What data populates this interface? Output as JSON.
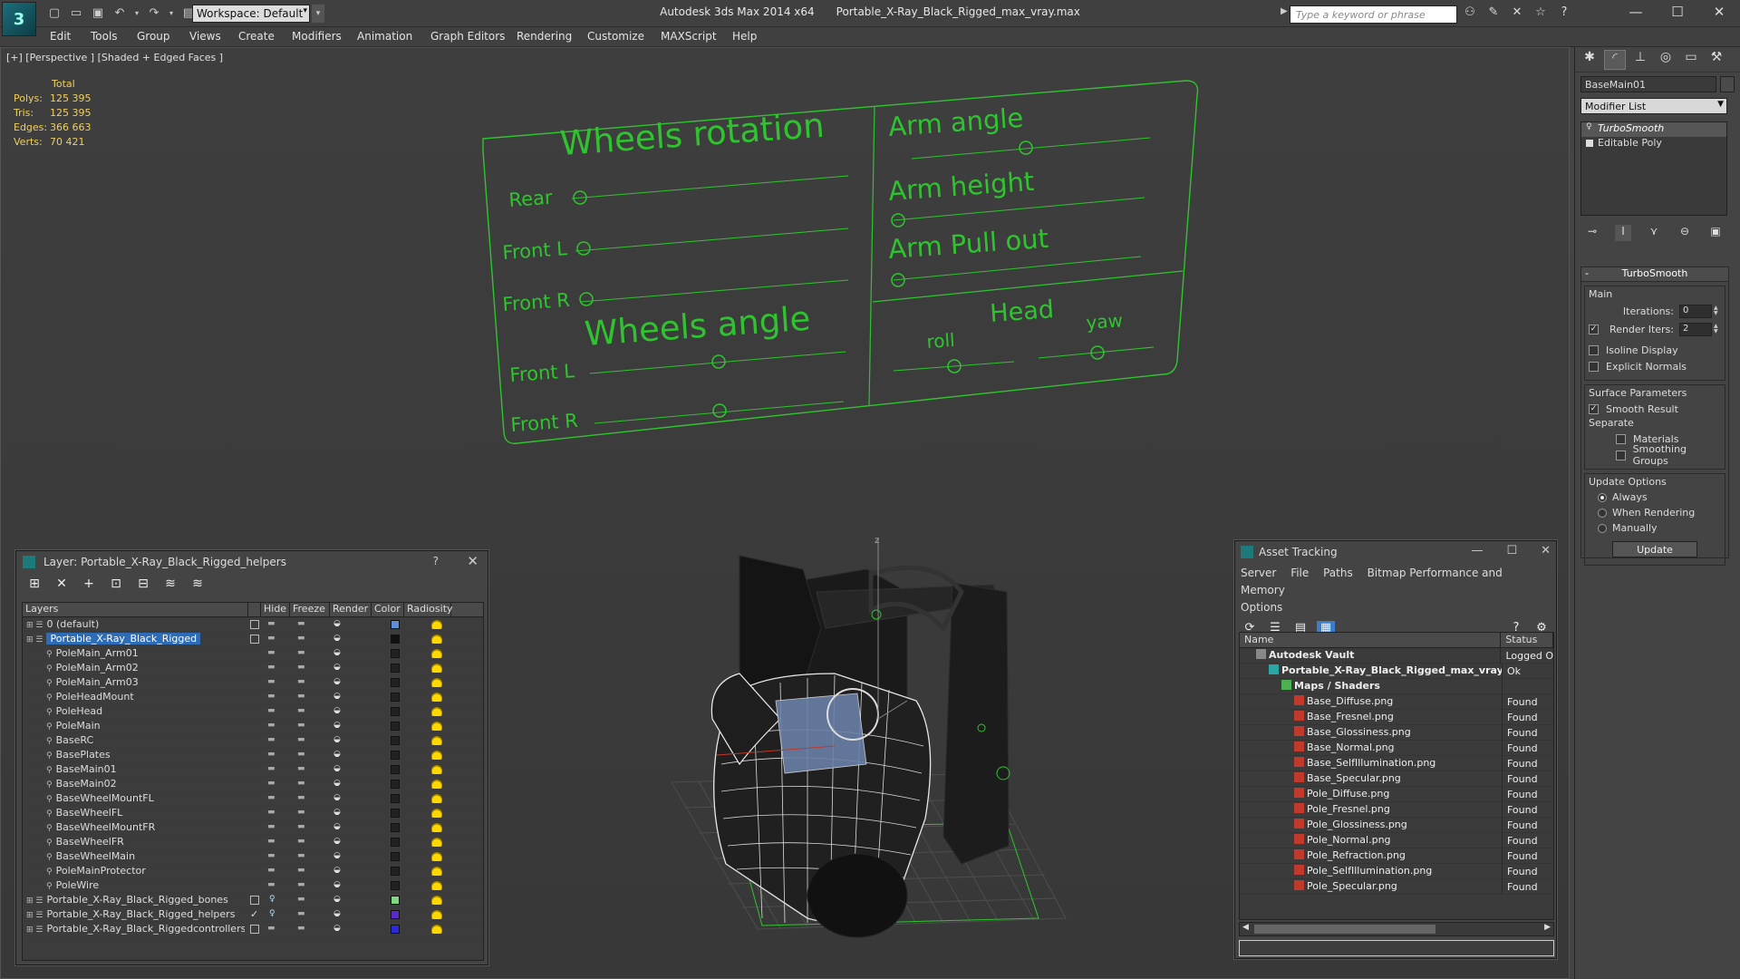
{
  "window": {
    "app_title": "Autodesk 3ds Max  2014 x64",
    "file_title": "Portable_X-Ray_Black_Rigged_max_vray.max",
    "workspace_label": "Workspace: Default",
    "search_placeholder": "Type a keyword or phrase"
  },
  "menu": [
    "Edit",
    "Tools",
    "Group",
    "Views",
    "Create",
    "Modifiers",
    "Animation",
    "Graph Editors",
    "Rendering",
    "Customize",
    "MAXScript",
    "Help"
  ],
  "viewport": {
    "label": "[+] [Perspective ] [Shaded + Edged Faces ]",
    "stats": {
      "header": "Total",
      "rows": [
        {
          "k": "Polys:",
          "v": "125 395"
        },
        {
          "k": "Tris:",
          "v": "125 395"
        },
        {
          "k": "Edges:",
          "v": "366 663"
        },
        {
          "k": "Verts:",
          "v": "70 421"
        }
      ]
    },
    "control_panel": {
      "wheels_rotation": "Wheels rotation",
      "rear": "Rear",
      "front_l": "Front L",
      "front_r": "Front R",
      "wheels_angle": "Wheels angle",
      "arm_angle": "Arm angle",
      "arm_height": "Arm height",
      "arm_pull_out": "Arm Pull out",
      "head": "Head",
      "roll": "roll",
      "yaw": "yaw"
    },
    "gizmo_axis": "z"
  },
  "layer_panel": {
    "title": "Layer: Portable_X-Ray_Black_Rigged_helpers",
    "help": "?",
    "columns": [
      "Layers",
      "Hide",
      "Freeze",
      "Render",
      "Color",
      "Radiosity"
    ],
    "rows": [
      {
        "name": "0 (default)",
        "level": 1,
        "color": "#5b8fd8",
        "current": true,
        "check": false
      },
      {
        "name": "Portable_X-Ray_Black_Rigged",
        "level": 1,
        "color": "#111111",
        "current": true,
        "selected": true
      },
      {
        "name": "PoleMain_Arm01",
        "level": 2,
        "color": "#222222"
      },
      {
        "name": "PoleMain_Arm02",
        "level": 2,
        "color": "#222222"
      },
      {
        "name": "PoleMain_Arm03",
        "level": 2,
        "color": "#222222"
      },
      {
        "name": "PoleHeadMount",
        "level": 2,
        "color": "#222222"
      },
      {
        "name": "PoleHead",
        "level": 2,
        "color": "#222222"
      },
      {
        "name": "PoleMain",
        "level": 2,
        "color": "#222222"
      },
      {
        "name": "BaseRC",
        "level": 2,
        "color": "#222222"
      },
      {
        "name": "BasePlates",
        "level": 2,
        "color": "#222222"
      },
      {
        "name": "BaseMain01",
        "level": 2,
        "color": "#222222"
      },
      {
        "name": "BaseMain02",
        "level": 2,
        "color": "#222222"
      },
      {
        "name": "BaseWheelMountFL",
        "level": 2,
        "color": "#222222"
      },
      {
        "name": "BaseWheelFL",
        "level": 2,
        "color": "#222222"
      },
      {
        "name": "BaseWheelMountFR",
        "level": 2,
        "color": "#222222"
      },
      {
        "name": "BaseWheelFR",
        "level": 2,
        "color": "#222222"
      },
      {
        "name": "BaseWheelMain",
        "level": 2,
        "color": "#222222"
      },
      {
        "name": "PoleMainProtector",
        "level": 2,
        "color": "#222222"
      },
      {
        "name": "PoleWire",
        "level": 2,
        "color": "#222222"
      },
      {
        "name": "Portable_X-Ray_Black_Rigged_bones",
        "level": 1,
        "color": "#7fd87f",
        "current": true,
        "hidden": true
      },
      {
        "name": "Portable_X-Ray_Black_Rigged_helpers",
        "level": 1,
        "color": "#5a2ac8",
        "check": true,
        "hidden": true
      },
      {
        "name": "Portable_X-Ray_Black_Riggedcontrollers",
        "level": 1,
        "color": "#2a2ad8",
        "current": true
      }
    ]
  },
  "asset_panel": {
    "title": "Asset Tracking",
    "menu": [
      "Server",
      "File",
      "Paths",
      "Bitmap Performance and Memory",
      "Options"
    ],
    "columns": [
      "Name",
      "Status"
    ],
    "rows": [
      {
        "name": "Autodesk Vault",
        "status": "Logged O",
        "indent": 1,
        "type": "vault"
      },
      {
        "name": "Portable_X-Ray_Black_Rigged_max_vray.max",
        "status": "Ok",
        "indent": 2,
        "type": "max"
      },
      {
        "name": "Maps / Shaders",
        "status": "",
        "indent": 3,
        "type": "maps"
      },
      {
        "name": "Base_Diffuse.png",
        "status": "Found",
        "indent": 4,
        "type": "png"
      },
      {
        "name": "Base_Fresnel.png",
        "status": "Found",
        "indent": 4,
        "type": "png"
      },
      {
        "name": "Base_Glossiness.png",
        "status": "Found",
        "indent": 4,
        "type": "png"
      },
      {
        "name": "Base_Normal.png",
        "status": "Found",
        "indent": 4,
        "type": "png"
      },
      {
        "name": "Base_SelfIllumination.png",
        "status": "Found",
        "indent": 4,
        "type": "png"
      },
      {
        "name": "Base_Specular.png",
        "status": "Found",
        "indent": 4,
        "type": "png"
      },
      {
        "name": "Pole_Diffuse.png",
        "status": "Found",
        "indent": 4,
        "type": "png"
      },
      {
        "name": "Pole_Fresnel.png",
        "status": "Found",
        "indent": 4,
        "type": "png"
      },
      {
        "name": "Pole_Glossiness.png",
        "status": "Found",
        "indent": 4,
        "type": "png"
      },
      {
        "name": "Pole_Normal.png",
        "status": "Found",
        "indent": 4,
        "type": "png"
      },
      {
        "name": "Pole_Refraction.png",
        "status": "Found",
        "indent": 4,
        "type": "png"
      },
      {
        "name": "Pole_SelfIllumination.png",
        "status": "Found",
        "indent": 4,
        "type": "png"
      },
      {
        "name": "Pole_Specular.png",
        "status": "Found",
        "indent": 4,
        "type": "png"
      }
    ]
  },
  "command_panel": {
    "object_name": "BaseMain01",
    "modifier_list": "Modifier List",
    "stack": [
      "TurboSmooth",
      "Editable Poly"
    ],
    "rollout": {
      "title": "TurboSmooth",
      "toggle": "-",
      "main_label": "Main",
      "iterations_label": "Iterations:",
      "iterations_value": "0",
      "render_iters_label": "Render Iters:",
      "render_iters_value": "2",
      "isoline": "Isoline Display",
      "explicit_normals": "Explicit Normals",
      "surface_label": "Surface Parameters",
      "smooth_result": "Smooth Result",
      "separate_label": "Separate",
      "materials": "Materials",
      "smoothing_groups": "Smoothing Groups",
      "update_label": "Update Options",
      "always": "Always",
      "when_rendering": "When Rendering",
      "manually": "Manually",
      "update_button": "Update"
    }
  },
  "colors": {
    "accent_green": "#2fc42f",
    "selection_blue": "#2c6cb8",
    "stats_yellow": "#f0d060"
  }
}
